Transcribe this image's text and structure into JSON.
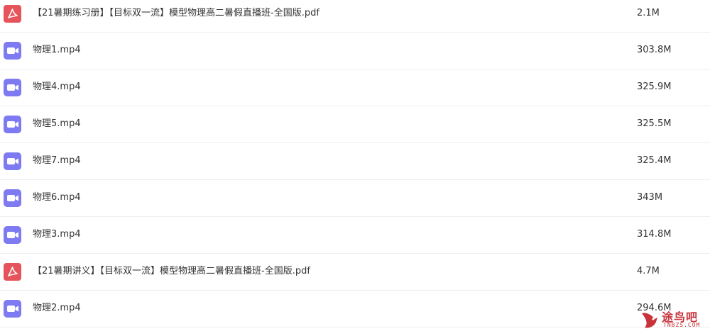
{
  "colors": {
    "pdf_icon": "#e5545b",
    "video_icon": "#7e7bf2",
    "row_divider": "#eeeeee",
    "text": "#333333",
    "watermark": "#c8323a"
  },
  "files": [
    {
      "name": "【21暑期练习册】【目标双一流】模型物理高二暑假直播班-全国版.pdf",
      "size": "2.1M",
      "type": "pdf",
      "icon": "pdf-icon"
    },
    {
      "name": "物理1.mp4",
      "size": "303.8M",
      "type": "video",
      "icon": "video-icon"
    },
    {
      "name": "物理4.mp4",
      "size": "325.9M",
      "type": "video",
      "icon": "video-icon"
    },
    {
      "name": "物理5.mp4",
      "size": "325.5M",
      "type": "video",
      "icon": "video-icon"
    },
    {
      "name": "物理7.mp4",
      "size": "325.4M",
      "type": "video",
      "icon": "video-icon"
    },
    {
      "name": "物理6.mp4",
      "size": "343M",
      "type": "video",
      "icon": "video-icon"
    },
    {
      "name": "物理3.mp4",
      "size": "314.8M",
      "type": "video",
      "icon": "video-icon"
    },
    {
      "name": "【21暑期讲义】【目标双一流】模型物理高二暑假直播班-全国版.pdf",
      "size": "4.7M",
      "type": "pdf",
      "icon": "pdf-icon"
    },
    {
      "name": "物理2.mp4",
      "size": "294.6M",
      "type": "video",
      "icon": "video-icon"
    }
  ],
  "watermark": {
    "text": "途鸟吧",
    "subtext": "TNBZS.COM"
  }
}
